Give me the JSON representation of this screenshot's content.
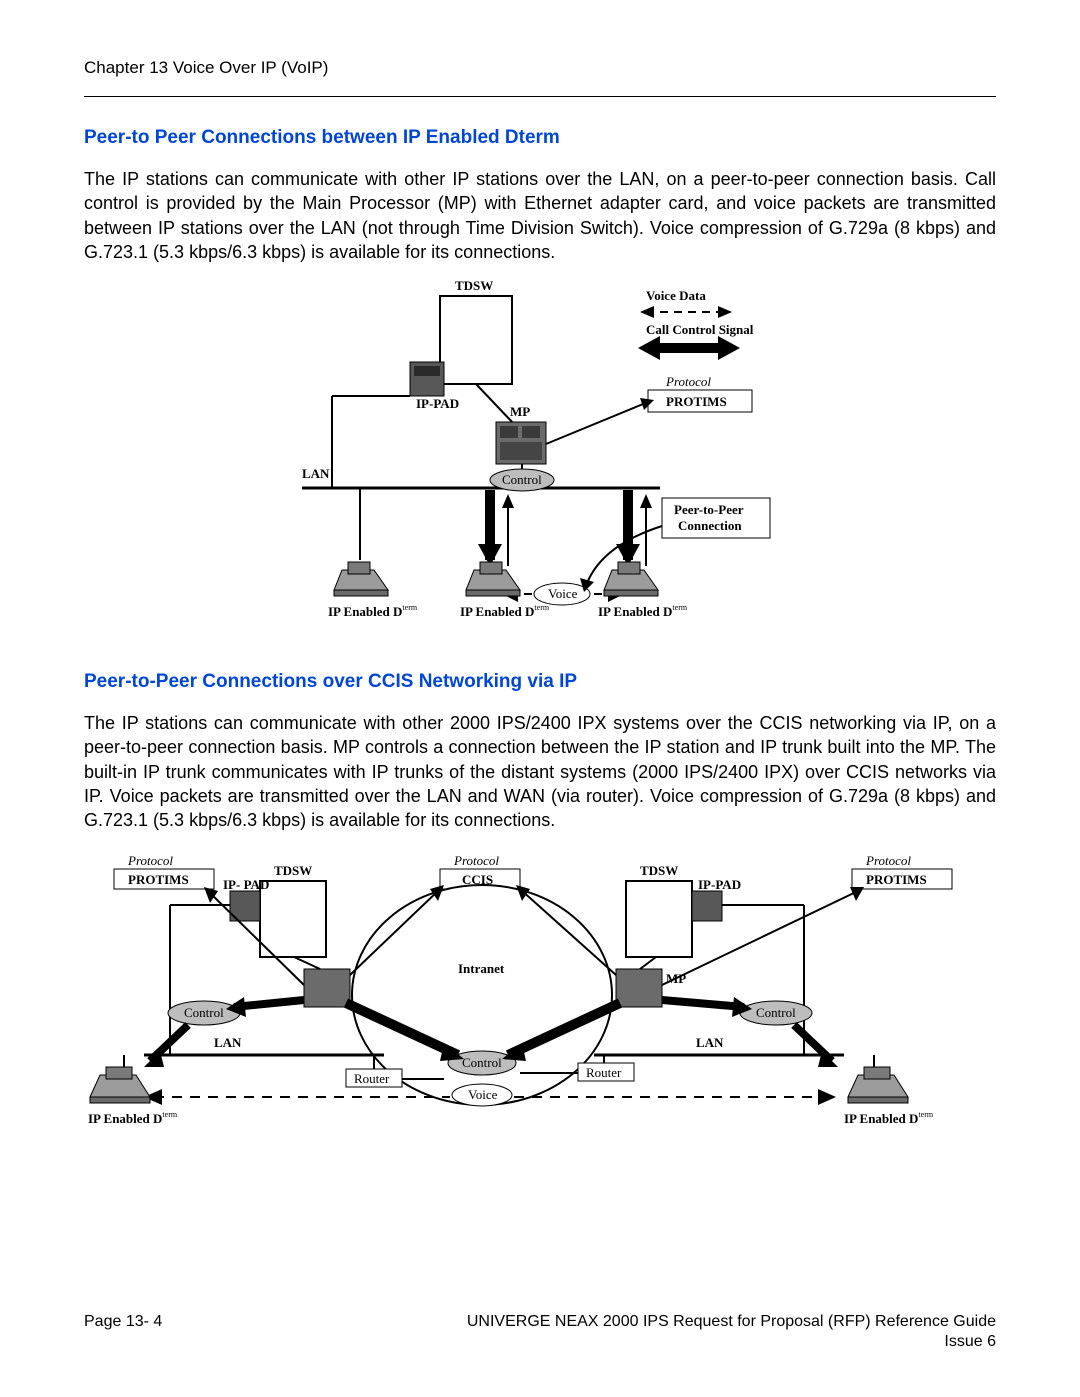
{
  "header": {
    "chapter": "Chapter 13 Voice Over IP (VoIP)"
  },
  "section1": {
    "title": "Peer-to Peer Connections between IP Enabled Dterm",
    "paragraph": "The IP stations can communicate with other IP stations over the LAN, on a peer-to-peer connection basis.  Call control is provided by the Main Processor (MP) with Ethernet adapter card, and voice packets are transmitted between IP stations over the LAN (not through Time Division Switch). Voice compression of G.729a (8 kbps) and G.723.1 (5.3 kbps/6.3 kbps) is available for its connections.",
    "diagram": {
      "TDSW": "TDSW",
      "IP_PAD": "IP-PAD",
      "MP": "MP",
      "LAN": "LAN",
      "Control": "Control",
      "Voice": "Voice",
      "VoiceData": "Voice Data",
      "CallControl": "Call Control Signal",
      "Protocol": "Protocol",
      "PROTIMS": "PROTIMS",
      "PeerBox1": "Peer-to-Peer",
      "PeerBox2": "Connection",
      "IPEnabled": "IP Enabled D",
      "term": "term"
    }
  },
  "section2": {
    "title": "Peer-to-Peer Connections over CCIS Networking via IP",
    "paragraph": "The IP stations can communicate with other 2000 IPS/2400 IPX systems over the CCIS networking via IP, on a peer-to-peer connection basis. MP controls a connection between the IP station and IP trunk built into the MP. The built-in IP trunk communicates with IP trunks of the distant systems (2000 IPS/2400 IPX) over CCIS networks via IP. Voice packets are transmitted over the LAN and WAN (via router). Voice compression of G.729a (8 kbps) and G.723.1 (5.3 kbps/6.3 kbps) is available for its connections.",
    "diagram": {
      "Protocol": "Protocol",
      "PROTIMS": "PROTIMS",
      "CCIS": "CCIS",
      "TDSW": "TDSW",
      "IP_PAD": "IP-PAD",
      "IP_PAD2": "IP- PAD",
      "MP": "MP",
      "LAN": "LAN",
      "Control": "Control",
      "Intranet": "Intranet",
      "Router": "Router",
      "Voice": "Voice",
      "IPEnabled": "IP Enabled D",
      "term": "term"
    }
  },
  "footer": {
    "page": "Page 13- 4",
    "doc": "UNIVERGE NEAX 2000 IPS Request for Proposal (RFP) Reference Guide",
    "issue": "Issue 6"
  }
}
